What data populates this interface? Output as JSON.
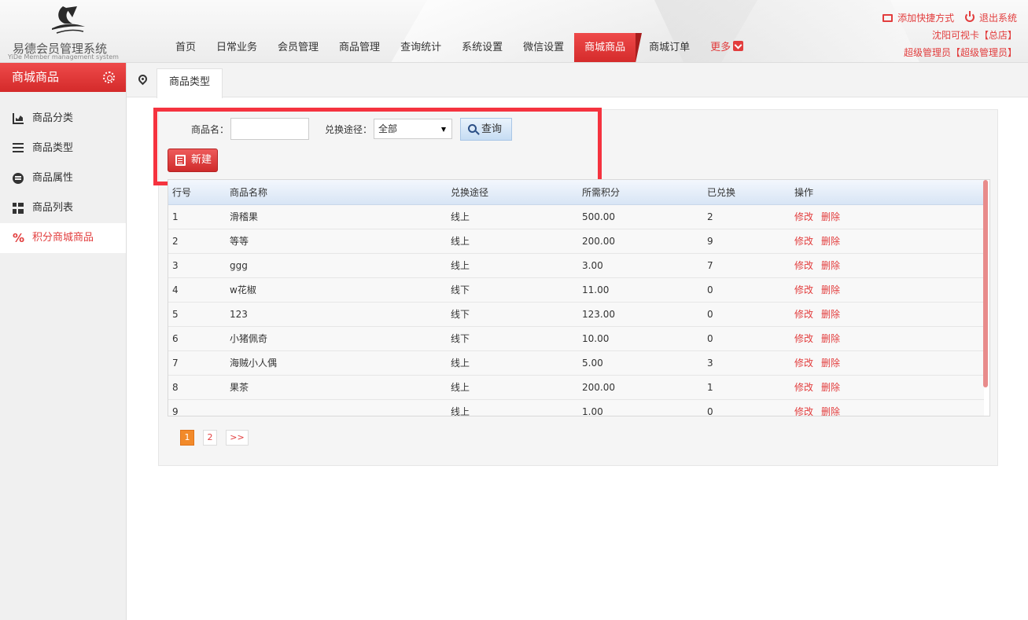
{
  "header": {
    "logo_text": "易德会员管理系统",
    "logo_sub": "YiDe Member management system",
    "nav": [
      "首页",
      "日常业务",
      "会员管理",
      "商品管理",
      "查询统计",
      "系统设置",
      "微信设置",
      "商城商品",
      "商城订单"
    ],
    "active_nav": "商城商品",
    "more_label": "更多",
    "add_shortcut": "添加快捷方式",
    "logout": "退出系统",
    "store_line": "沈阳可视卡【总店】",
    "user_line": "超级管理员【超级管理员】"
  },
  "sidebar": {
    "title": "商城商品",
    "items": [
      {
        "label": "商品分类",
        "icon": "chart-icon"
      },
      {
        "label": "商品类型",
        "icon": "list-icon"
      },
      {
        "label": "商品属性",
        "icon": "attribute-icon"
      },
      {
        "label": "商品列表",
        "icon": "grid-icon"
      },
      {
        "label": "积分商城商品",
        "icon": "percent-icon",
        "active": true
      }
    ]
  },
  "tabs": {
    "current": "商品类型"
  },
  "search": {
    "name_label": "商品名：",
    "name_value": "",
    "route_label": "兑换途径：",
    "route_value": "全部",
    "query_button": "查询",
    "new_button": "新建"
  },
  "table": {
    "headers": [
      "行号",
      "商品名称",
      "兑换途径",
      "所需积分",
      "已兑换",
      "操作"
    ],
    "edit_label": "修改",
    "delete_label": "删除",
    "rows": [
      [
        "1",
        "滑稽果",
        "线上",
        "500.00",
        "2"
      ],
      [
        "2",
        "等等",
        "线上",
        "200.00",
        "9"
      ],
      [
        "3",
        "ggg",
        "线上",
        "3.00",
        "7"
      ],
      [
        "4",
        "w花椒",
        "线下",
        "11.00",
        "0"
      ],
      [
        "5",
        "123",
        "线下",
        "123.00",
        "0"
      ],
      [
        "6",
        "小猪佩奇",
        "线下",
        "10.00",
        "0"
      ],
      [
        "7",
        "海贼小人偶",
        "线上",
        "5.00",
        "3"
      ],
      [
        "8",
        "果茶",
        "线上",
        "200.00",
        "1"
      ],
      [
        "9",
        "",
        "线上",
        "1.00",
        "0"
      ]
    ]
  },
  "pagination": {
    "pages": [
      "1",
      "2"
    ],
    "current": "1",
    "next": ">>"
  },
  "colors": {
    "accent": "#e23d3d",
    "highlight_box": "#f5333f",
    "current_page": "#f28a2a"
  }
}
